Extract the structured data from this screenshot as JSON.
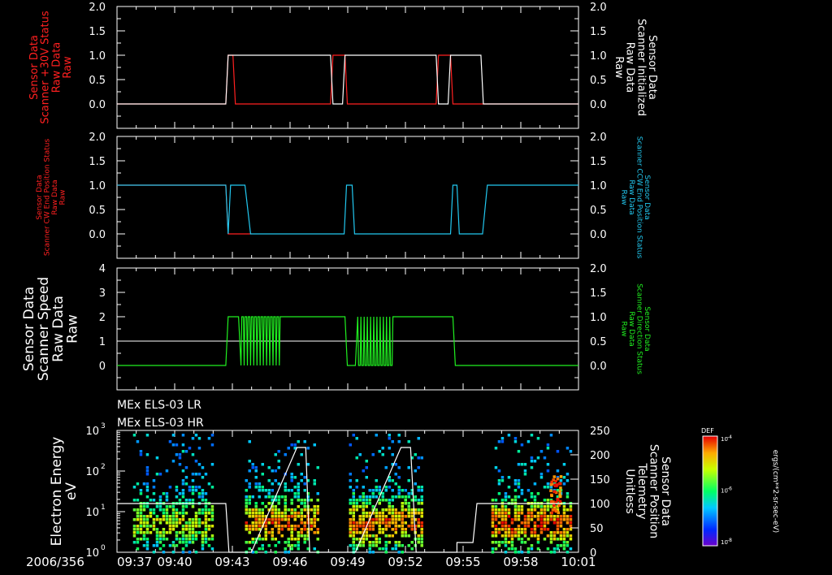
{
  "colors": {
    "background": "#000000",
    "axes": "#ffffff",
    "red": "#ff2020",
    "cyan": "#22c8f0",
    "green": "#20f020",
    "white": "#ffffff"
  },
  "chart_data": [
    {
      "type": "line",
      "panel": "p1",
      "left_label": [
        "Sensor Data",
        "Scanner +30V Status",
        "Raw Data",
        "Raw"
      ],
      "right_label": [
        "Sensor Data",
        "Scanner Initialized",
        "Raw Data",
        "Raw"
      ],
      "left_ylim": [
        -0.5,
        2.0
      ],
      "right_ylim": [
        -0.5,
        2.0
      ],
      "left_ticks": [
        "0.0",
        "0.5",
        "1.0",
        "1.5",
        "2.0"
      ],
      "right_ticks": [
        "0.0",
        "0.5",
        "1.0",
        "1.5",
        "2.0"
      ],
      "series": [
        {
          "color": "red",
          "values": [
            [
              0,
              0
            ],
            [
              136,
              0
            ],
            [
              139,
              1
            ],
            [
              145,
              1
            ],
            [
              148,
              0
            ],
            [
              267,
              0
            ],
            [
              270,
              1
            ],
            [
              285,
              1
            ],
            [
              288,
              0
            ],
            [
              399,
              0
            ],
            [
              402,
              1
            ],
            [
              417,
              1
            ],
            [
              420,
              0
            ],
            [
              577,
              0
            ]
          ]
        },
        {
          "color": "white",
          "values": [
            [
              0,
              0
            ],
            [
              136,
              0
            ],
            [
              139,
              1
            ],
            [
              267,
              1
            ],
            [
              270,
              0
            ],
            [
              282,
              0
            ],
            [
              285,
              1
            ],
            [
              399,
              1
            ],
            [
              402,
              0
            ],
            [
              414,
              0
            ],
            [
              417,
              1
            ],
            [
              455,
              1
            ],
            [
              458,
              0
            ],
            [
              577,
              0
            ]
          ]
        }
      ]
    },
    {
      "type": "line",
      "panel": "p2",
      "left_label": [
        "Sensor Data",
        "Scanner CW End Position Status",
        "Raw Data",
        "Raw"
      ],
      "right_label": [
        "Sensor Data",
        "Scanner CCW End Position Status",
        "Raw Data",
        "Raw"
      ],
      "left_ylim": [
        -0.5,
        2.0
      ],
      "right_ylim": [
        -0.5,
        2.0
      ],
      "left_ticks": [
        "0.0",
        "0.5",
        "1.0",
        "1.5",
        "2.0"
      ],
      "right_ticks": [
        "0.0",
        "0.5",
        "1.0",
        "1.5",
        "2.0"
      ],
      "series": [
        {
          "color": "red",
          "values": [
            [
              0,
              1
            ],
            [
              136,
              1
            ],
            [
              139,
              0
            ],
            [
              168,
              0
            ],
            [
              171,
              1
            ],
            [
              0,
              1
            ]
          ]
        },
        {
          "color": "cyan",
          "values": [
            [
              0,
              1
            ],
            [
              136,
              1
            ],
            [
              139,
              0
            ],
            [
              142,
              1
            ],
            [
              160,
              1
            ],
            [
              167,
              0
            ],
            [
              284,
              0
            ],
            [
              287,
              1
            ],
            [
              294,
              1
            ],
            [
              297,
              0
            ],
            [
              417,
              0
            ],
            [
              420,
              1
            ],
            [
              425,
              1
            ],
            [
              428,
              0
            ],
            [
              457,
              0
            ],
            [
              463,
              1
            ],
            [
              577,
              1
            ]
          ]
        }
      ]
    },
    {
      "type": "line",
      "panel": "p3",
      "left_label": [
        "Sensor Data",
        "Scanner Speed",
        "Raw Data",
        "Raw"
      ],
      "right_label": [
        "Sensor Data",
        "Scanner Direction Status",
        "Raw Data",
        "Raw"
      ],
      "left_ylim": [
        -1,
        4
      ],
      "right_ylim": [
        -0.5,
        2.0
      ],
      "left_ticks": [
        "0",
        "1",
        "2",
        "3",
        "4"
      ],
      "right_ticks": [
        "0.0",
        "0.5",
        "1.0",
        "1.5",
        "2.0"
      ],
      "hline": 1,
      "series": [
        {
          "color": "green",
          "values": "square-pulses"
        }
      ]
    },
    {
      "type": "heatmap",
      "panel": "p4",
      "instruments": [
        "MEx ELS-03 LR",
        "MEx ELS-03 HR"
      ],
      "left_label": [
        "Electron Energy",
        "eV"
      ],
      "right_label": [
        "Sensor Data",
        "Scanner Position",
        "Telemetry",
        "Unitless"
      ],
      "left_ticks": [
        "10",
        "10",
        "10",
        "10"
      ],
      "left_exps": [
        "0",
        "1",
        "2",
        "3"
      ],
      "right_ylim": [
        0,
        250
      ],
      "right_ticks": [
        "0",
        "50",
        "100",
        "150",
        "200",
        "250"
      ],
      "colorbar": {
        "title": "DEF",
        "ticks": [
          "10",
          "10",
          "10"
        ],
        "exps": [
          "-4",
          "-6",
          "-8"
        ],
        "units": "ergs/(cm**2-sr-sec-eV)"
      }
    }
  ],
  "x_axis": {
    "date_label": "2006/356",
    "tick_labels": [
      "09:37",
      "09:40",
      "09:43",
      "09:46",
      "09:49",
      "09:52",
      "09:55",
      "09:58",
      "10:01"
    ]
  }
}
